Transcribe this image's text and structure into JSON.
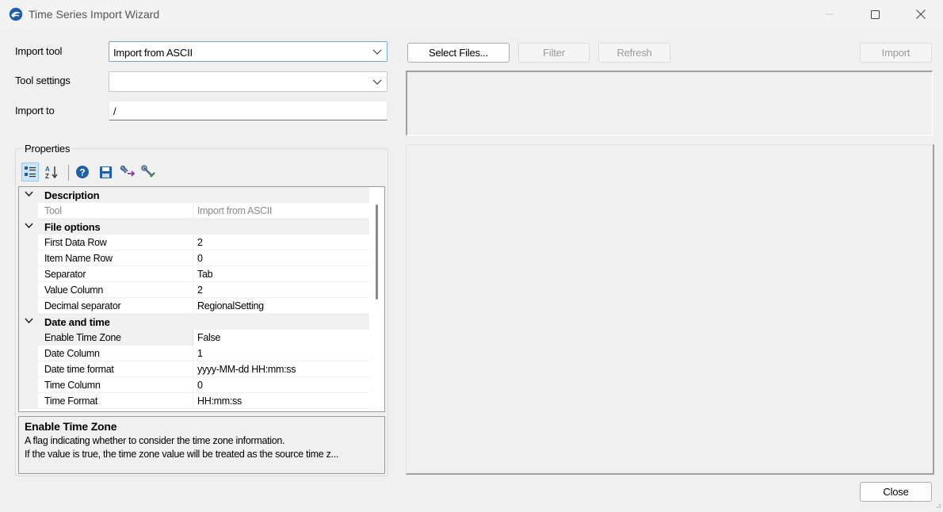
{
  "window": {
    "title": "Time Series Import Wizard",
    "icon": "dhi-logo-icon"
  },
  "form": {
    "import_tool_label": "Import tool",
    "import_tool_value": "Import from ASCII",
    "tool_settings_label": "Tool settings",
    "tool_settings_value": "",
    "import_to_label": "Import to",
    "import_to_value": "/"
  },
  "properties": {
    "legend": "Properties",
    "toolbar": [
      "categorized-icon",
      "alphabetical-sort-icon",
      "help-icon",
      "save-icon",
      "load-settings-icon",
      "tools-icon"
    ],
    "categories": [
      {
        "name": "Description",
        "rows": [
          {
            "name": "Tool",
            "value": "Import from ASCII",
            "readonly": true
          }
        ]
      },
      {
        "name": "File options",
        "rows": [
          {
            "name": "First Data Row",
            "value": "2"
          },
          {
            "name": "Item Name Row",
            "value": "0"
          },
          {
            "name": "Separator",
            "value": "Tab"
          },
          {
            "name": "Value Column",
            "value": "2"
          },
          {
            "name": "Decimal separator",
            "value": "RegionalSetting"
          }
        ]
      },
      {
        "name": "Date and time",
        "rows": [
          {
            "name": "Enable Time Zone",
            "value": "False",
            "selected": true
          },
          {
            "name": "Date Column",
            "value": "1"
          },
          {
            "name": "Date time format",
            "value": "yyyy-MM-dd HH:mm:ss"
          },
          {
            "name": "Time Column",
            "value": "0"
          },
          {
            "name": "Time Format",
            "value": "HH:mm:ss"
          }
        ]
      }
    ],
    "help": {
      "title": "Enable Time Zone",
      "line1": "A flag indicating whether to consider the time zone information.",
      "line2": "If the value is true, the time zone value will be treated as the source time z..."
    }
  },
  "buttons": {
    "select_files": "Select Files...",
    "filter": "Filter",
    "refresh": "Refresh",
    "import": "Import",
    "close": "Close"
  }
}
